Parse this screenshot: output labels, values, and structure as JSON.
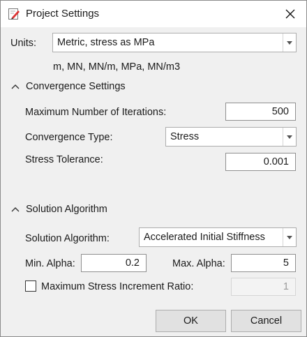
{
  "window": {
    "title": "Project Settings"
  },
  "units": {
    "label": "Units:",
    "selected": "Metric, stress as MPa",
    "summary": "m, MN, MN/m, MPa, MN/m3"
  },
  "convergence": {
    "header": "Convergence Settings",
    "max_iterations_label": "Maximum Number of Iterations:",
    "max_iterations_value": "500",
    "type_label": "Convergence Type:",
    "type_selected": "Stress",
    "tolerance_label": "Stress Tolerance:",
    "tolerance_value": "0.001"
  },
  "solution": {
    "header": "Solution Algorithm",
    "algorithm_label": "Solution Algorithm:",
    "algorithm_selected": "Accelerated Initial Stiffness",
    "min_alpha_label": "Min. Alpha:",
    "min_alpha_value": "0.2",
    "max_alpha_label": "Max. Alpha:",
    "max_alpha_value": "5",
    "max_stress_ratio_label": "Maximum Stress Increment Ratio:",
    "max_stress_ratio_checked": false,
    "max_stress_ratio_value": "1"
  },
  "buttons": {
    "ok": "OK",
    "cancel": "Cancel"
  }
}
